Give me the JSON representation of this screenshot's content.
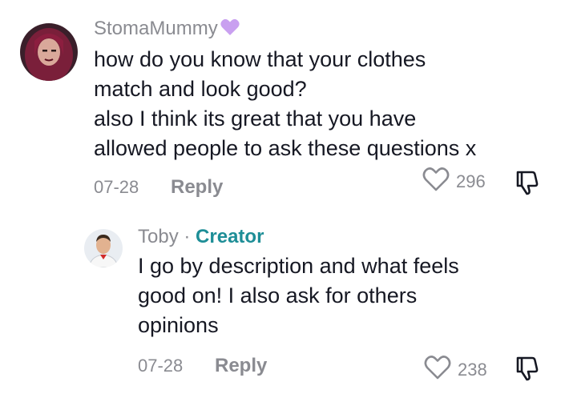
{
  "comments": [
    {
      "username": "StomaMummy",
      "badge_icon": "purple-heart-icon",
      "text_lines": [
        "how do you know that your clothes",
        "match and look good?",
        "also I think its great that you have",
        "allowed people to ask these questions x"
      ],
      "date": "07-28",
      "reply_label": "Reply",
      "likes": "296"
    },
    {
      "username": "Toby",
      "separator": "·",
      "creator_label": "Creator",
      "text_lines": [
        "I go by description and what feels",
        "good on! I also ask for others",
        "opinions"
      ],
      "date": "07-28",
      "reply_label": "Reply",
      "likes": "238"
    }
  ],
  "colors": {
    "muted": "#8a8b91",
    "text": "#161823",
    "creator": "#1e8e97",
    "heart_badge": "#c9a0f0"
  }
}
